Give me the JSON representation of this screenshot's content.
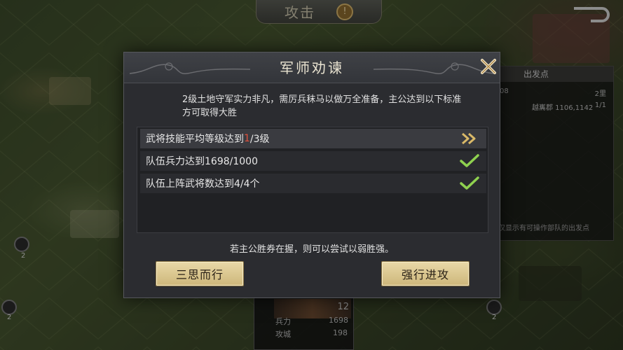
{
  "top_tab": {
    "label": "攻击",
    "icon": "info-icon",
    "icon_glyph": "!"
  },
  "side_panel": {
    "header": "出发点",
    "row1_left": "08",
    "row1_right": "2里",
    "row2_left": "越巂郡 1106,1142",
    "row2_right": "1/1",
    "note": "仅显示有可操作部队的出发点"
  },
  "unit_card": {
    "level": "12",
    "stat1_label": "兵力",
    "stat1_value": "1698",
    "stat2_label": "攻城",
    "stat2_value": "198"
  },
  "map_pins": [
    "2",
    "2",
    "2"
  ],
  "dialog": {
    "title": "军师劝谏",
    "message": "2级土地守军实力非凡，需厉兵秣马以做万全准备，主公达到以下标准方可取得大胜",
    "conditions": [
      {
        "prefix": "武将技能平均等级达到",
        "highlight": "1",
        "suffix": "/3级",
        "status": "arrow-icon"
      },
      {
        "prefix": "队伍兵力达到1698/1000",
        "highlight": "",
        "suffix": "",
        "status": "check-icon"
      },
      {
        "prefix": "队伍上阵武将数达到4/4个",
        "highlight": "",
        "suffix": "",
        "status": "check-icon"
      }
    ],
    "hint": "若主公胜券在握，则可以尝试以弱胜强。",
    "cancel_label": "三思而行",
    "confirm_label": "强行进攻",
    "colors": {
      "highlight": "#e0503c",
      "check": "#8fd14f",
      "button": "#e2cf98"
    }
  }
}
